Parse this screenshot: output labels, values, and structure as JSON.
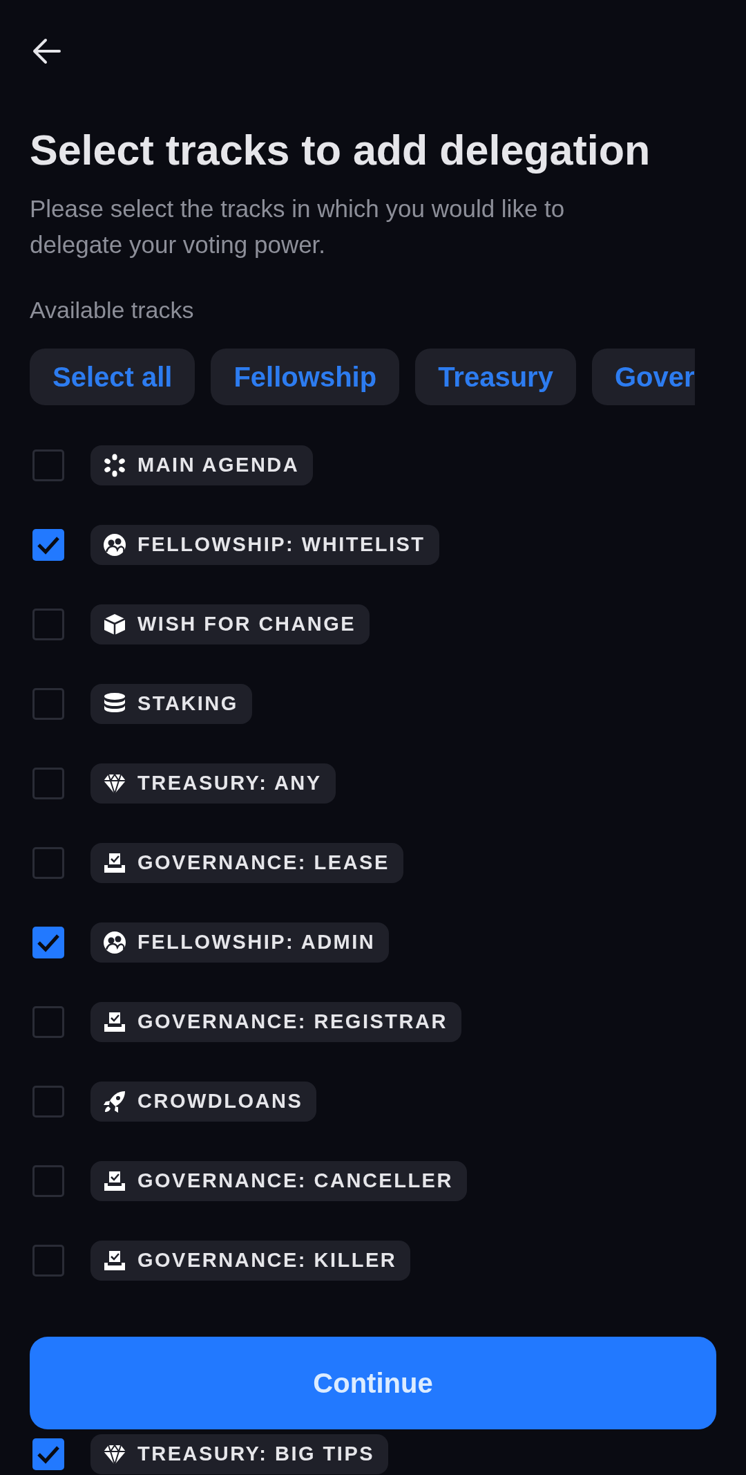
{
  "header": {
    "title": "Select tracks to add delegation",
    "subtitle": "Please select the tracks in which you would like to delegate your voting power."
  },
  "section_label": "Available tracks",
  "filters": [
    {
      "label": "Select all"
    },
    {
      "label": "Fellowship"
    },
    {
      "label": "Treasury"
    },
    {
      "label": "Gover"
    }
  ],
  "tracks": [
    {
      "label": "MAIN AGENDA",
      "kind": "root",
      "checked": false
    },
    {
      "label": "FELLOWSHIP: WHITELIST",
      "kind": "fellowship",
      "checked": true
    },
    {
      "label": "WISH FOR CHANGE",
      "kind": "wish",
      "checked": false
    },
    {
      "label": "STAKING",
      "kind": "staking",
      "checked": false
    },
    {
      "label": "TREASURY: ANY",
      "kind": "treasury",
      "checked": false
    },
    {
      "label": "GOVERNANCE: LEASE",
      "kind": "governance",
      "checked": false
    },
    {
      "label": "FELLOWSHIP: ADMIN",
      "kind": "fellowship",
      "checked": true
    },
    {
      "label": "GOVERNANCE: REGISTRAR",
      "kind": "governance",
      "checked": false
    },
    {
      "label": "CROWDLOANS",
      "kind": "crowdloans",
      "checked": false
    },
    {
      "label": "GOVERNANCE: CANCELLER",
      "kind": "governance",
      "checked": false
    },
    {
      "label": "GOVERNANCE: KILLER",
      "kind": "governance",
      "checked": false
    },
    {
      "label": "TREASURY: BIG TIPS",
      "kind": "treasury",
      "checked": true
    }
  ],
  "continue_button": "Continue"
}
